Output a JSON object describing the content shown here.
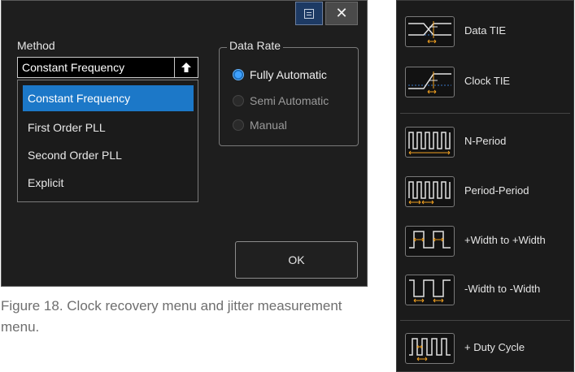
{
  "dialog": {
    "method_label": "Method",
    "method_value": "Constant Frequency",
    "method_options": [
      {
        "label": "Constant Frequency",
        "selected": true
      },
      {
        "label": "First Order PLL",
        "selected": false
      },
      {
        "label": "Second Order PLL",
        "selected": false
      },
      {
        "label": "Explicit",
        "selected": false
      }
    ],
    "data_rate_label": "Data Rate",
    "data_rate_options": [
      {
        "label": "Fully Automatic",
        "checked": true
      },
      {
        "label": "Semi Automatic",
        "checked": false
      },
      {
        "label": "Manual",
        "checked": false
      }
    ],
    "ok_label": "OK",
    "close_glyph": "✕"
  },
  "caption": "Figure 18. Clock recovery menu and jitter measurement menu.",
  "jitter_menu": {
    "items": [
      {
        "label": "Data TIE",
        "icon": "data-tie-icon"
      },
      {
        "label": "Clock TIE",
        "icon": "clock-tie-icon"
      },
      {
        "label": "N-Period",
        "icon": "n-period-icon"
      },
      {
        "label": "Period-Period",
        "icon": "period-period-icon"
      },
      {
        "label": "+Width to +Width",
        "icon": "pos-width-icon"
      },
      {
        "label": "-Width to -Width",
        "icon": "neg-width-icon"
      },
      {
        "label": "+ Duty Cycle",
        "icon": "duty-cycle-icon"
      }
    ]
  },
  "colors": {
    "selection": "#1c78c8",
    "trace": "#e2e2e2",
    "marker": "#f0a020",
    "panel_bg": "#1b1b1b"
  }
}
